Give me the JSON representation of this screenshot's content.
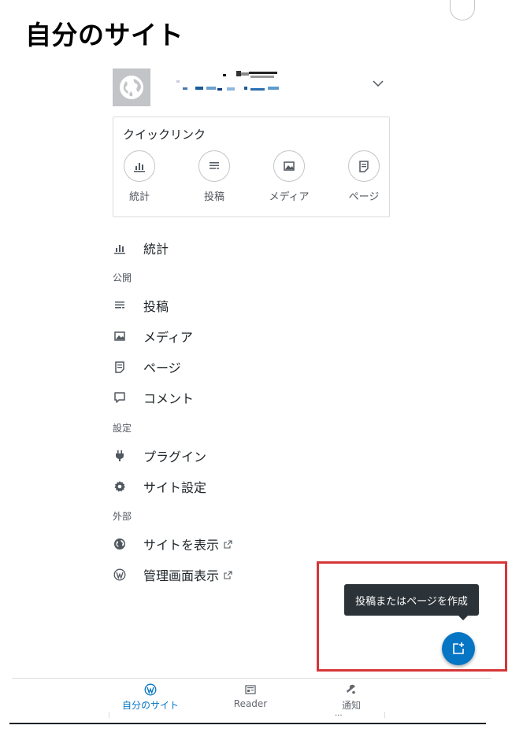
{
  "page": {
    "title": "自分のサイト"
  },
  "site": {
    "avatar_icon": "globe-icon",
    "switcher_icon": "chevron-down-icon"
  },
  "quick_links": {
    "title": "クイックリンク",
    "items": [
      {
        "label": "統計",
        "icon": "bar-chart-icon"
      },
      {
        "label": "投稿",
        "icon": "posts-icon"
      },
      {
        "label": "メディア",
        "icon": "image-icon"
      },
      {
        "label": "ページ",
        "icon": "page-icon"
      }
    ]
  },
  "menu": {
    "stats": "統計",
    "section_publish": "公開",
    "posts": "投稿",
    "media": "メディア",
    "pages": "ページ",
    "comments": "コメント",
    "section_settings": "設定",
    "plugins": "プラグイン",
    "site_settings": "サイト設定",
    "section_external": "外部",
    "view_site": "サイトを表示",
    "wp_admin": "管理画面表示"
  },
  "fab": {
    "tooltip": "投稿またはページを作成",
    "icon": "add-post-icon"
  },
  "tabbar": {
    "my_site": "自分のサイト",
    "reader": "Reader",
    "notifications": "通知",
    "ellipsis": "..."
  },
  "colors": {
    "accent": "#0675c4",
    "highlight_border": "#d63638",
    "tooltip_bg": "#2c3338"
  }
}
